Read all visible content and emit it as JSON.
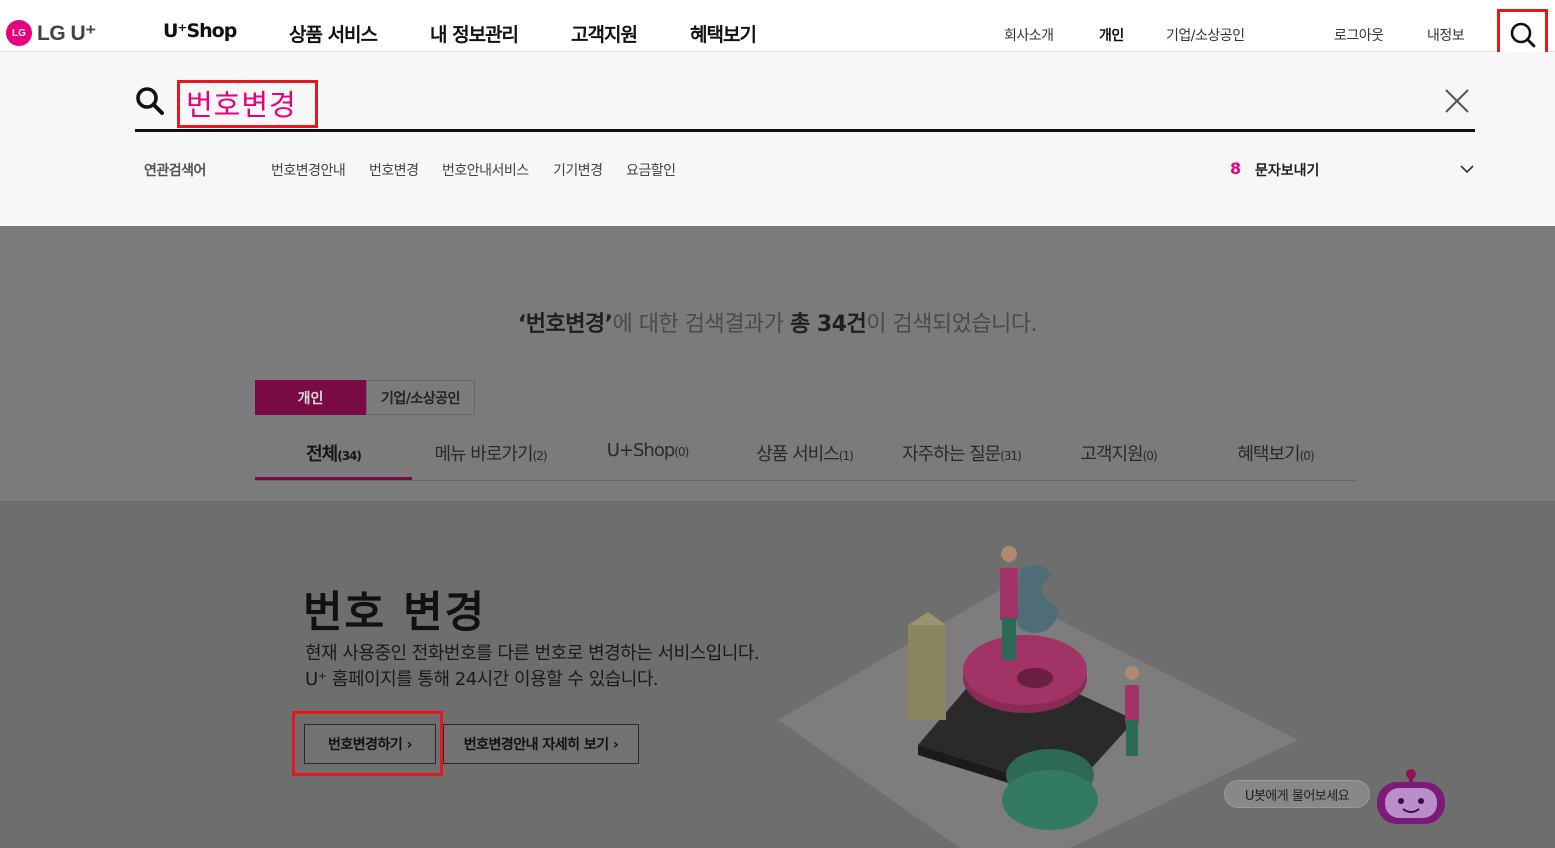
{
  "header": {
    "logo_text": "LG U⁺",
    "nav": [
      "U⁺Shop",
      "상품 서비스",
      "내 정보관리",
      "고객지원",
      "혜택보기"
    ],
    "util": [
      "회사소개",
      "개인",
      "기업/소상공인",
      "로그아웃",
      "내정보"
    ]
  },
  "search": {
    "query": "번호변경",
    "related_label": "연관검색어",
    "related": [
      "번호변경안내",
      "번호변경",
      "번호안내서비스",
      "기기변경",
      "요금할인"
    ],
    "rank_number": "8",
    "rank_text": "문자보내기"
  },
  "result": {
    "query_quoted": "‘번호변경’",
    "mid": "에 대한 검색결과가 ",
    "total": "총 34건",
    "suffix": "이 검색되었습니다."
  },
  "segments": [
    "개인",
    "기업/소상공인"
  ],
  "tabs": [
    {
      "label": "전체",
      "count": "(34)"
    },
    {
      "label": "메뉴 바로가기",
      "count": "(2)"
    },
    {
      "label": "U+Shop",
      "count": "(0)"
    },
    {
      "label": "상품 서비스",
      "count": "(1)"
    },
    {
      "label": "자주하는 질문",
      "count": "(31)"
    },
    {
      "label": "고객지원",
      "count": "(0)"
    },
    {
      "label": "혜택보기",
      "count": "(0)"
    }
  ],
  "card": {
    "title": "번호 변경",
    "desc_line1": "현재 사용중인 전화번호를 다른 번호로 변경하는 서비스입니다.",
    "desc_line2": "U⁺ 홈페이지를 통해 24시간 이용할 수 있습니다.",
    "primary_button": "번호변경하기 ›",
    "secondary_button": "번호변경안내 자세히 보기 ›"
  },
  "chatbot": {
    "bubble": "U봇에게 물어보세요"
  },
  "colors": {
    "brand": "#e6007e",
    "tab_active": "#7a0a44",
    "highlight": "#e8161f"
  }
}
